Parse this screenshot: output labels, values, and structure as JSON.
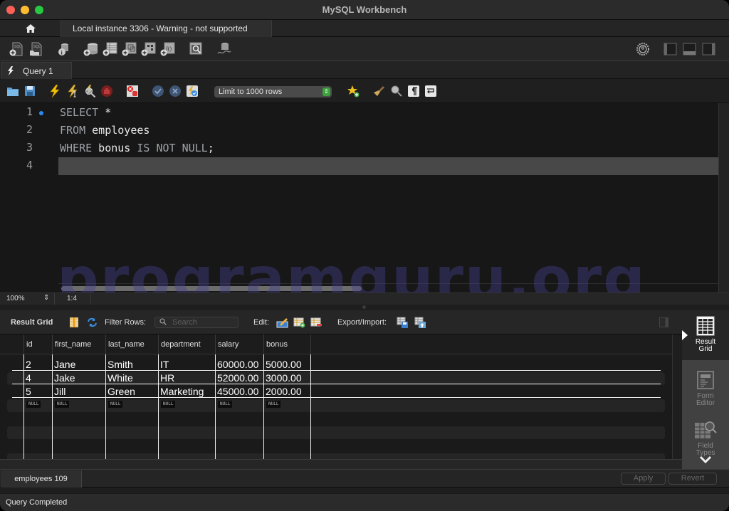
{
  "window": {
    "title": "MySQL Workbench"
  },
  "connection_tabs": {
    "home_icon": "home-icon",
    "active_tab": "Local instance 3306 - Warning - not supported"
  },
  "main_toolbar": {
    "icons": [
      "new-sql-tab-icon",
      "open-sql-script-icon",
      "schema-inspector-icon",
      "create-schema-icon",
      "create-table-icon",
      "create-view-icon",
      "create-procedure-icon",
      "create-function-icon",
      "search-table-data-icon",
      "reconnect-icon",
      "settings-icon",
      "toggle-sidebar-icon",
      "toggle-output-icon",
      "toggle-secondary-sidebar-icon"
    ]
  },
  "query_tab": {
    "label": "Query 1"
  },
  "sql_toolbar": {
    "limit_select": "Limit to 1000 rows",
    "icons": [
      "open-file-icon",
      "save-icon",
      "execute-icon",
      "execute-current-icon",
      "explain-icon",
      "stop-icon",
      "toggle-error-icon",
      "commit-icon",
      "rollback-icon",
      "autocommit-icon",
      "add-snippet-icon",
      "beautify-icon",
      "find-icon",
      "invisible-chars-icon",
      "word-wrap-icon"
    ]
  },
  "editor": {
    "lines": [
      {
        "no": "1",
        "kw1": "SELECT",
        "rest": " *"
      },
      {
        "no": "2",
        "kw1": "FROM",
        "rest": " employees"
      },
      {
        "no": "3",
        "kw1": "WHERE",
        "rest": " bonus ",
        "kw2": "IS NOT NULL",
        "tail": ";"
      },
      {
        "no": "4",
        "kw1": "",
        "rest": ""
      }
    ],
    "zoom": "100%",
    "cursor": "1:4"
  },
  "result_toolbar": {
    "title": "Result Grid",
    "filter_label": "Filter Rows:",
    "search_placeholder": "Search",
    "edit_label": "Edit:",
    "export_label": "Export/Import:"
  },
  "grid": {
    "columns": [
      "id",
      "first_name",
      "last_name",
      "department",
      "salary",
      "bonus"
    ],
    "rows": [
      [
        "2",
        "Jane",
        "Smith",
        "IT",
        "60000.00",
        "5000.00"
      ],
      [
        "4",
        "Jake",
        "White",
        "HR",
        "52000.00",
        "3000.00"
      ],
      [
        "5",
        "Jill",
        "Green",
        "Marketing",
        "45000.00",
        "2000.00"
      ]
    ],
    "null_label": "NULL"
  },
  "side_panel": {
    "items": [
      {
        "label1": "Result",
        "label2": "Grid"
      },
      {
        "label1": "Form",
        "label2": "Editor"
      },
      {
        "label1": "Field",
        "label2": "Types"
      }
    ]
  },
  "bottom": {
    "result_tab": "employees 109",
    "apply": "Apply",
    "revert": "Revert"
  },
  "status": {
    "text": "Query Completed"
  },
  "watermark": "programguru.org"
}
